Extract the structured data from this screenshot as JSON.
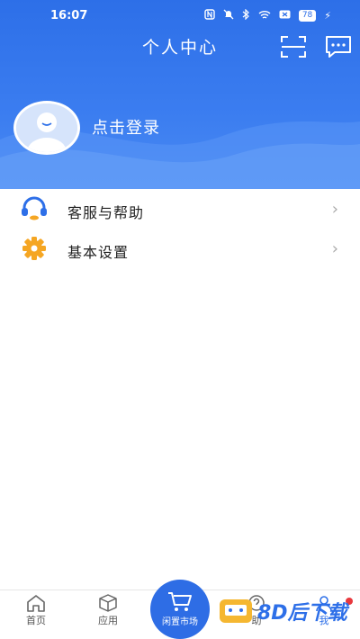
{
  "status": {
    "time": "16:07",
    "battery": "78"
  },
  "header": {
    "title": "个人中心",
    "login_label": "点击登录"
  },
  "menu": [
    {
      "label": "客服与帮助",
      "icon": "headset-icon"
    },
    {
      "label": "基本设置",
      "icon": "gear-icon"
    }
  ],
  "tabs": [
    {
      "label": "首页",
      "icon": "home-icon"
    },
    {
      "label": "应用",
      "icon": "box-icon"
    },
    {
      "label": "闲置市场",
      "icon": "cart-icon"
    },
    {
      "label": "助",
      "icon": "help-icon"
    },
    {
      "label": "我",
      "icon": "user-icon"
    }
  ],
  "watermark": {
    "text": "8D后下载"
  },
  "colors": {
    "primary": "#2d6fe8",
    "accent_orange": "#f5a623"
  }
}
